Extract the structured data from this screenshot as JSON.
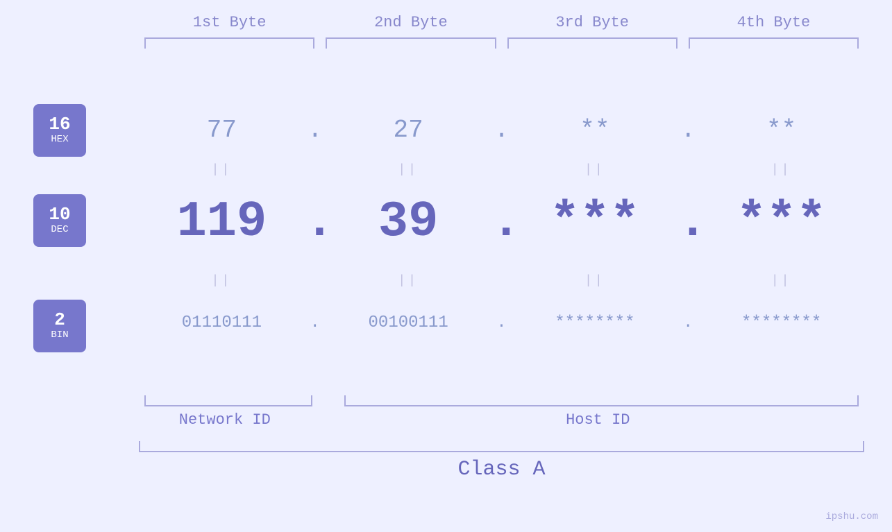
{
  "header": {
    "byte1_label": "1st Byte",
    "byte2_label": "2nd Byte",
    "byte3_label": "3rd Byte",
    "byte4_label": "4th Byte"
  },
  "badges": {
    "hex": {
      "num": "16",
      "label": "HEX"
    },
    "dec": {
      "num": "10",
      "label": "DEC"
    },
    "bin": {
      "num": "2",
      "label": "BIN"
    }
  },
  "rows": {
    "hex": {
      "b1": "77",
      "dot1": ".",
      "b2": "27",
      "dot2": ".",
      "b3": "**",
      "dot3": ".",
      "b4": "**"
    },
    "dec": {
      "b1": "119.",
      "b1_num": "119",
      "dot1": ".",
      "b2": "39.",
      "b2_num": "39",
      "dot2": ".",
      "b3": "***",
      "dot3": ".",
      "b4": "***"
    },
    "bin": {
      "b1": "01110111",
      "dot1": ".",
      "b2": "00100111",
      "dot2": ".",
      "b3": "********",
      "dot3": ".",
      "b4": "********"
    }
  },
  "separator": "||",
  "labels": {
    "network_id": "Network ID",
    "host_id": "Host ID",
    "class": "Class A"
  },
  "watermark": "ipshu.com",
  "colors": {
    "bg": "#eef0ff",
    "primary": "#7777cc",
    "light": "#aaaadd",
    "badge_bg": "#7777cc",
    "badge_text": "#ffffff"
  }
}
